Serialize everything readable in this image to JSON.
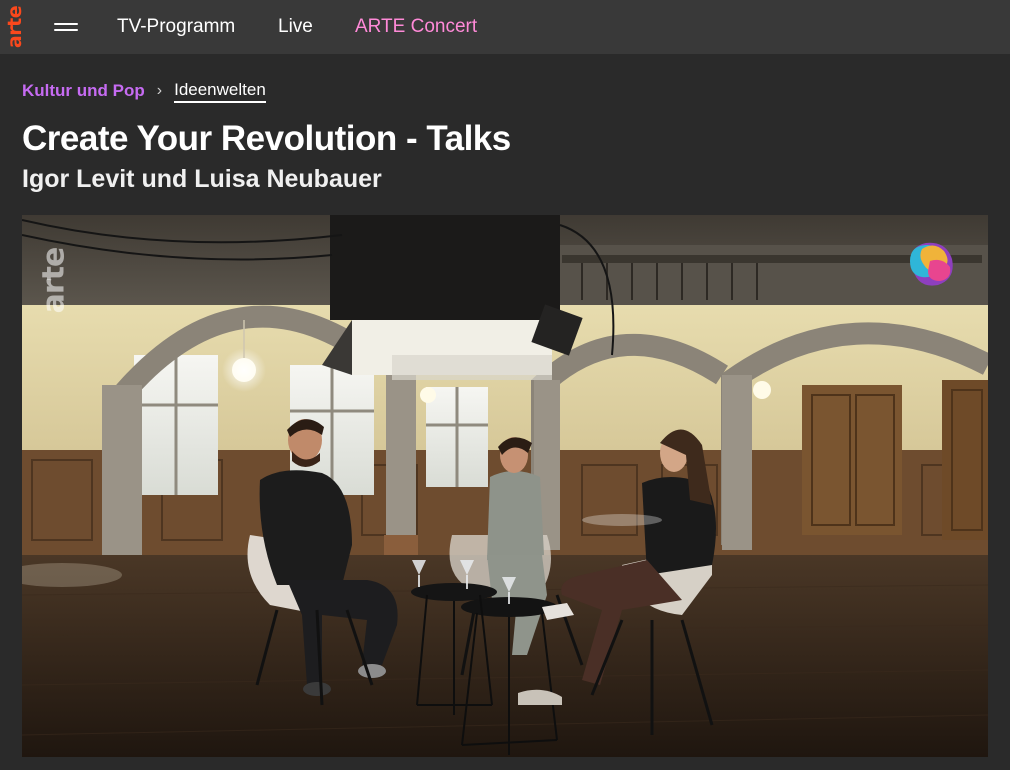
{
  "brand": {
    "logo_text": "arte",
    "logo_color": "#fa481c"
  },
  "nav": {
    "items": [
      {
        "label": "TV-Programm",
        "color": "#ffffff"
      },
      {
        "label": "Live",
        "color": "#ffffff"
      },
      {
        "label": "ARTE Concert",
        "color": "#ff8ad8"
      }
    ]
  },
  "breadcrumb": {
    "parent": "Kultur und Pop",
    "parent_color": "#c66bf2",
    "separator": ">",
    "current": "Ideenwelten"
  },
  "page": {
    "title": "Create Your Revolution - Talks",
    "subtitle": "Igor Levit und Luisa Neubauer"
  },
  "player": {
    "watermark": "arte",
    "badge_icon": "arte-concert-badge-icon"
  }
}
